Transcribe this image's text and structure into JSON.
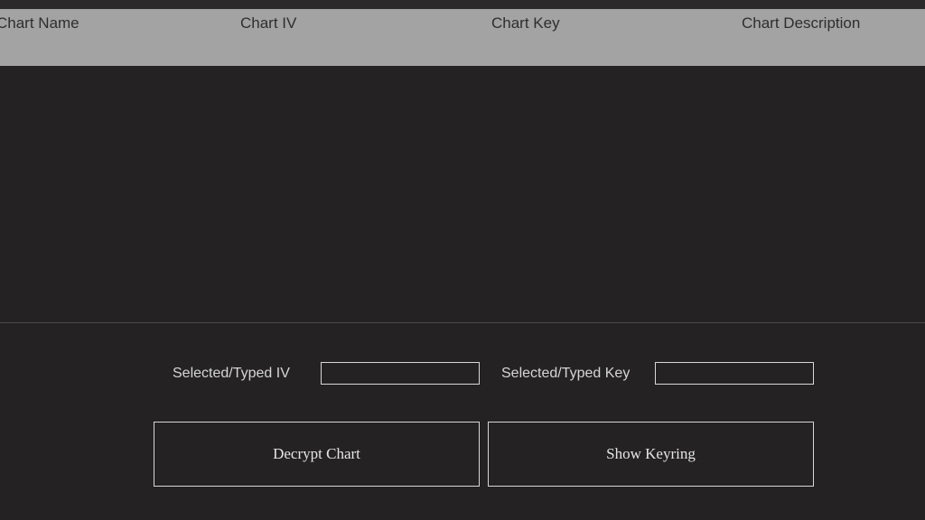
{
  "table": {
    "columns": [
      "Chart Name",
      "Chart IV",
      "Chart Key",
      "Chart Description"
    ],
    "rows": []
  },
  "form": {
    "iv_label": "Selected/Typed IV",
    "iv_value": "",
    "key_label": "Selected/Typed Key",
    "key_value": ""
  },
  "buttons": {
    "decrypt_label": "Decrypt Chart",
    "keyring_label": "Show Keyring"
  },
  "colors": {
    "background": "#242223",
    "header_background": "#a3a3a3",
    "border": "#d8d8d8"
  }
}
